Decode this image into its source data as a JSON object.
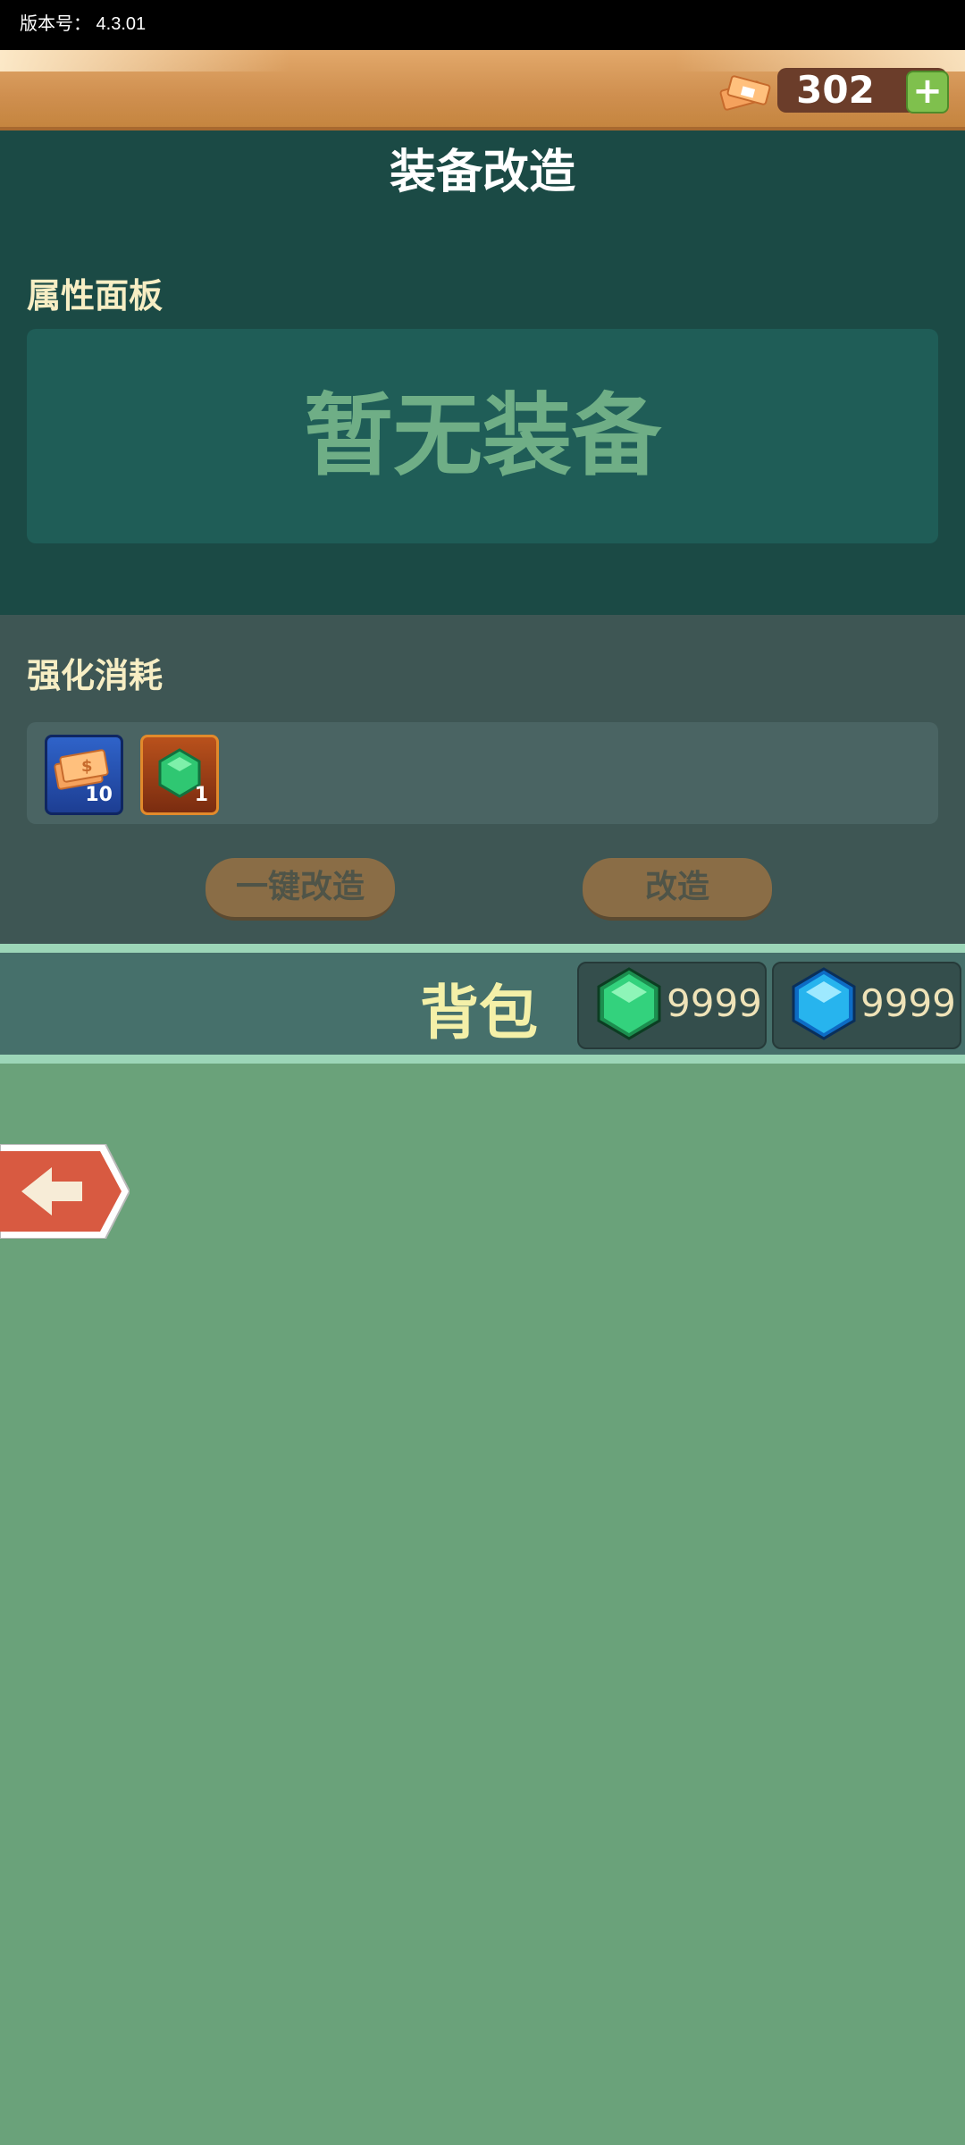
{
  "status_bar": {
    "version_label": "版本号：  4.3.01"
  },
  "header": {
    "currency_value": "302",
    "add_symbol": "+"
  },
  "page": {
    "title": "装备改造"
  },
  "attributes": {
    "title": "属性面板",
    "empty_text": "暂无装备"
  },
  "cost": {
    "title": "强化消耗",
    "items": [
      {
        "icon": "money-icon",
        "count": "10"
      },
      {
        "icon": "green-gem-icon",
        "count": "1"
      }
    ]
  },
  "buttons": {
    "one_click": "一键改造",
    "modify": "改造"
  },
  "bag": {
    "title": "背包",
    "resources": [
      {
        "icon": "green-gem-icon",
        "count": "9999"
      },
      {
        "icon": "blue-gem-icon",
        "count": "9999"
      }
    ]
  }
}
